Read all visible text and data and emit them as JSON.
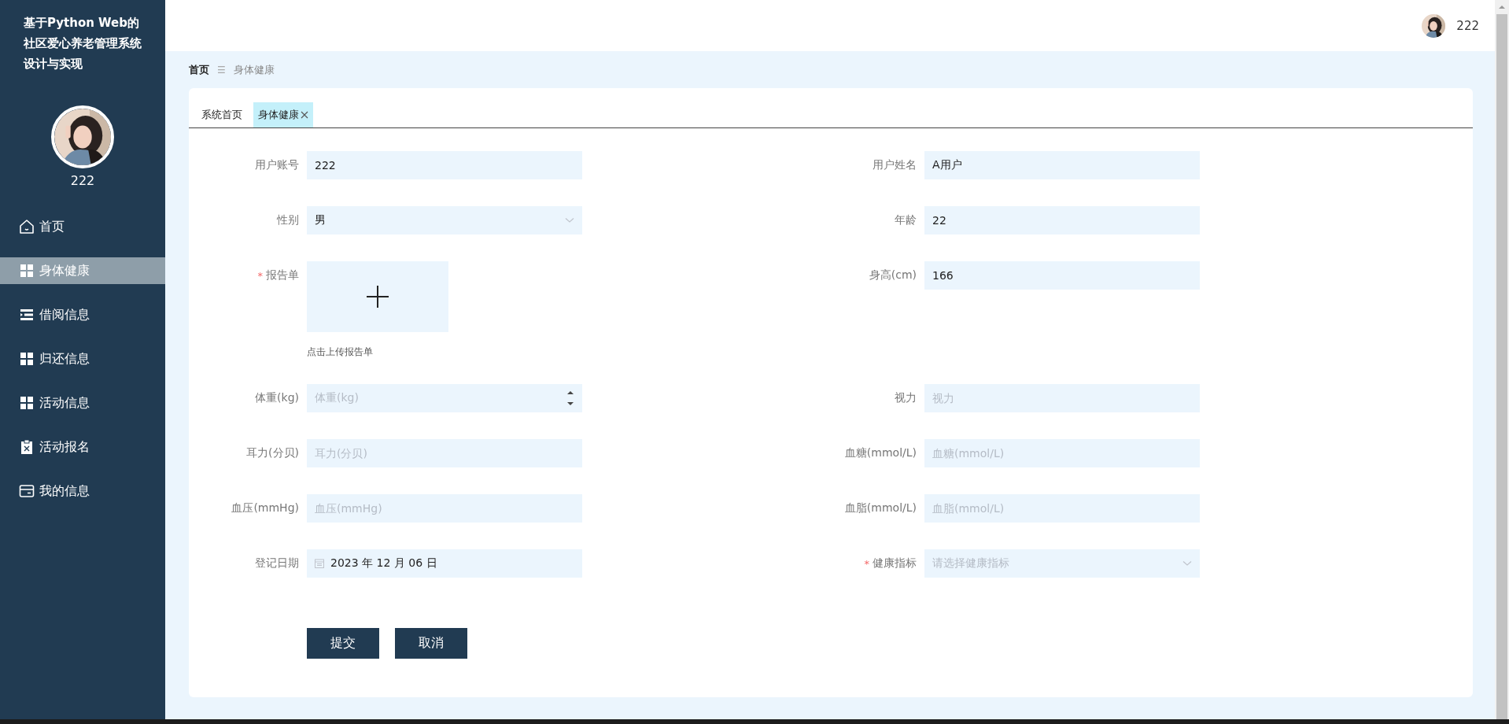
{
  "sidebar": {
    "title": "基于Python Web的社区爱心养老管理系统设计与实现",
    "username": "222",
    "items": [
      {
        "label": "首页",
        "selected": false
      },
      {
        "label": "身体健康",
        "selected": true
      },
      {
        "label": "借阅信息",
        "selected": false
      },
      {
        "label": "归还信息",
        "selected": false
      },
      {
        "label": "活动信息",
        "selected": false
      },
      {
        "label": "活动报名",
        "selected": false
      },
      {
        "label": "我的信息",
        "selected": false
      }
    ]
  },
  "header": {
    "username": "222"
  },
  "breadcrumb": {
    "items": [
      "首页",
      "身体健康"
    ],
    "separator": "☰"
  },
  "tabs": [
    {
      "label": "系统首页",
      "selected": false,
      "closable": false
    },
    {
      "label": "身体健康",
      "selected": true,
      "closable": true
    }
  ],
  "required_mark": "*",
  "form": {
    "fields": [
      {
        "kind": "text",
        "label": "用户账号",
        "value": "222",
        "required": false
      },
      {
        "kind": "text",
        "label": "用户姓名",
        "value": "A用户",
        "required": false
      },
      {
        "kind": "select",
        "label": "性别",
        "value": "男",
        "required": false
      },
      {
        "kind": "text",
        "label": "年龄",
        "value": "22",
        "required": false
      },
      {
        "kind": "upload",
        "label": "报告单",
        "hint": "点击上传报告单",
        "required": true
      },
      {
        "kind": "text",
        "label": "身高(cm)",
        "value": "166",
        "required": false
      },
      {
        "kind": "number",
        "label": "体重(kg)",
        "placeholder": "体重(kg)",
        "required": false
      },
      {
        "kind": "text",
        "label": "视力",
        "placeholder": "视力",
        "required": false
      },
      {
        "kind": "text",
        "label": "耳力(分贝)",
        "placeholder": "耳力(分贝)",
        "required": false
      },
      {
        "kind": "text",
        "label": "血糖(mmol/L)",
        "placeholder": "血糖(mmol/L)",
        "required": false
      },
      {
        "kind": "text",
        "label": "血压(mmHg)",
        "placeholder": "血压(mmHg)",
        "required": false
      },
      {
        "kind": "text",
        "label": "血脂(mmol/L)",
        "placeholder": "血脂(mmol/L)",
        "required": false
      },
      {
        "kind": "date",
        "label": "登记日期",
        "value": "2023 年 12 月 06 日",
        "required": false
      },
      {
        "kind": "select",
        "label": "健康指标",
        "placeholder": "请选择健康指标",
        "required": true
      }
    ],
    "buttons": [
      "提交",
      "取消"
    ]
  }
}
